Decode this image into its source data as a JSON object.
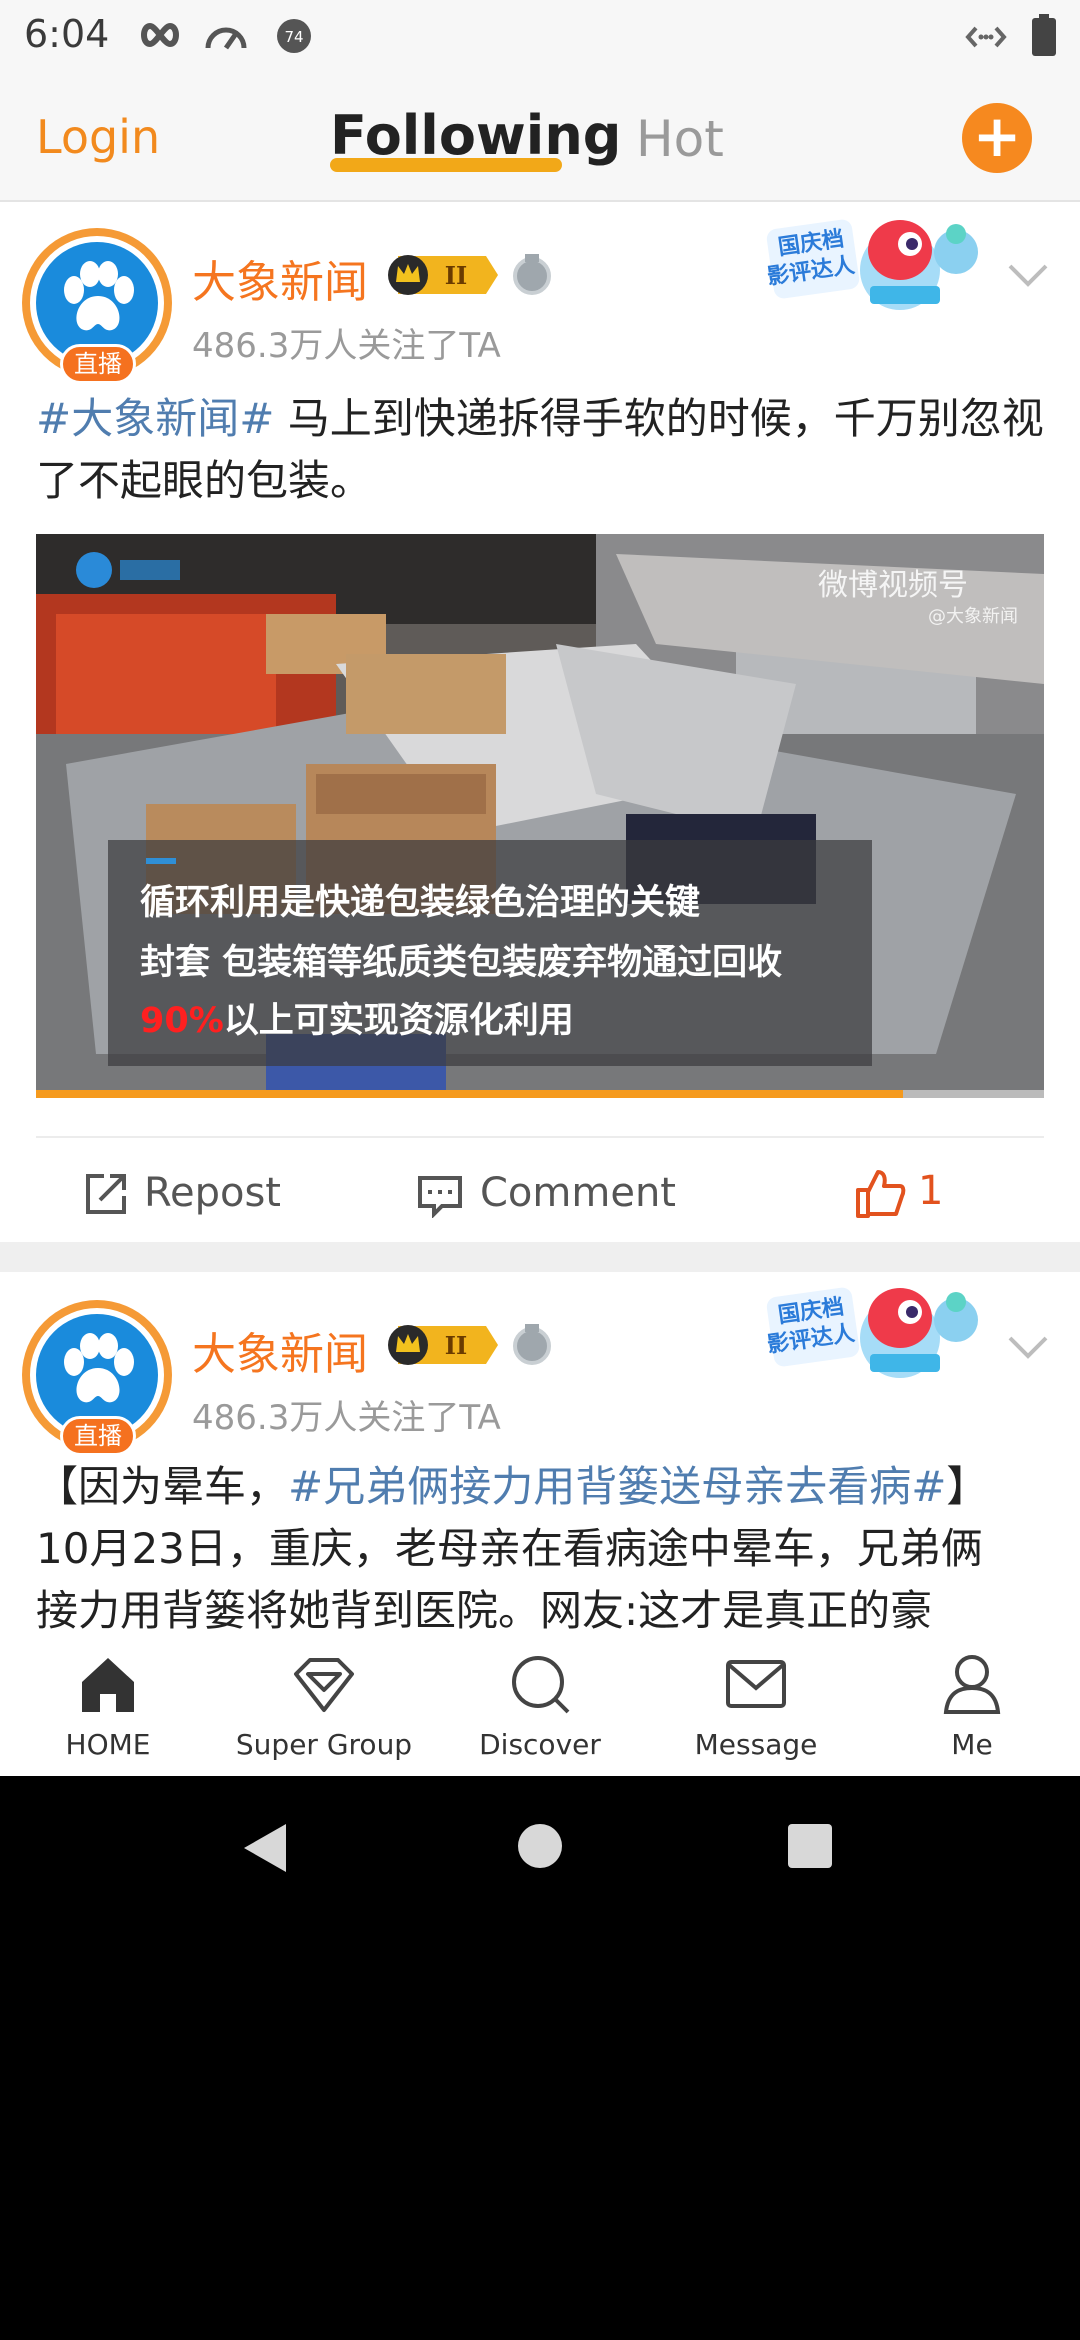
{
  "status_bar": {
    "time": "6:04",
    "icons": [
      "infinity-icon",
      "speedometer-icon",
      "notification-count-icon",
      "data-arrows-icon",
      "battery-icon"
    ],
    "notification_count": "74"
  },
  "topnav": {
    "login_label": "Login",
    "tabs": [
      {
        "label": "Following",
        "active": true
      },
      {
        "label": "Hot",
        "active": false
      }
    ],
    "accent_color": "#f6891f"
  },
  "posts": [
    {
      "author": "大象新闻",
      "level_badge": "II",
      "avatar_badge": "直播",
      "followers": "486.3万人关注了TA",
      "promo_text": "国庆档 影评达人",
      "text_hashtag": "#大象新闻#",
      "text_body": " 马上到快递拆得手软的时候，千万别忽视了不起眼的包装。",
      "video": {
        "watermark": "微博视频号",
        "watermark_sub": "@大象新闻",
        "caption_lines": [
          "循环利用是快递包装绿色治理的关键",
          "封套 包装箱等纸质类包装废弃物通过回收"
        ],
        "caption_highlight": "90%",
        "caption_line3": "以上可实现资源化利用",
        "progress_fraction": 0.86
      },
      "actions": {
        "repost_label": "Repost",
        "comment_label": "Comment",
        "like_count": "1"
      }
    },
    {
      "author": "大象新闻",
      "level_badge": "II",
      "avatar_badge": "直播",
      "followers": "486.3万人关注了TA",
      "promo_text": "国庆档 影评达人",
      "text_prefix": "【因为晕车，",
      "text_hashtag": "#兄弟俩接力用背篓送母亲去看病#",
      "text_suffix": "】",
      "text_line2": "10月23日，重庆，老母亲在看病途中晕车，兄弟俩",
      "text_line3": "接力用背篓将她背到医院。网友:这才是真正的豪"
    }
  ],
  "bottomnav": {
    "items": [
      {
        "label": "HOME",
        "icon": "home-icon"
      },
      {
        "label": "Super Group",
        "icon": "diamond-icon"
      },
      {
        "label": "Discover",
        "icon": "search-icon"
      },
      {
        "label": "Message",
        "icon": "envelope-icon"
      },
      {
        "label": "Me",
        "icon": "person-icon"
      }
    ]
  },
  "system_nav": {
    "icons": [
      "back-icon",
      "home-circle-icon",
      "recents-icon"
    ]
  }
}
